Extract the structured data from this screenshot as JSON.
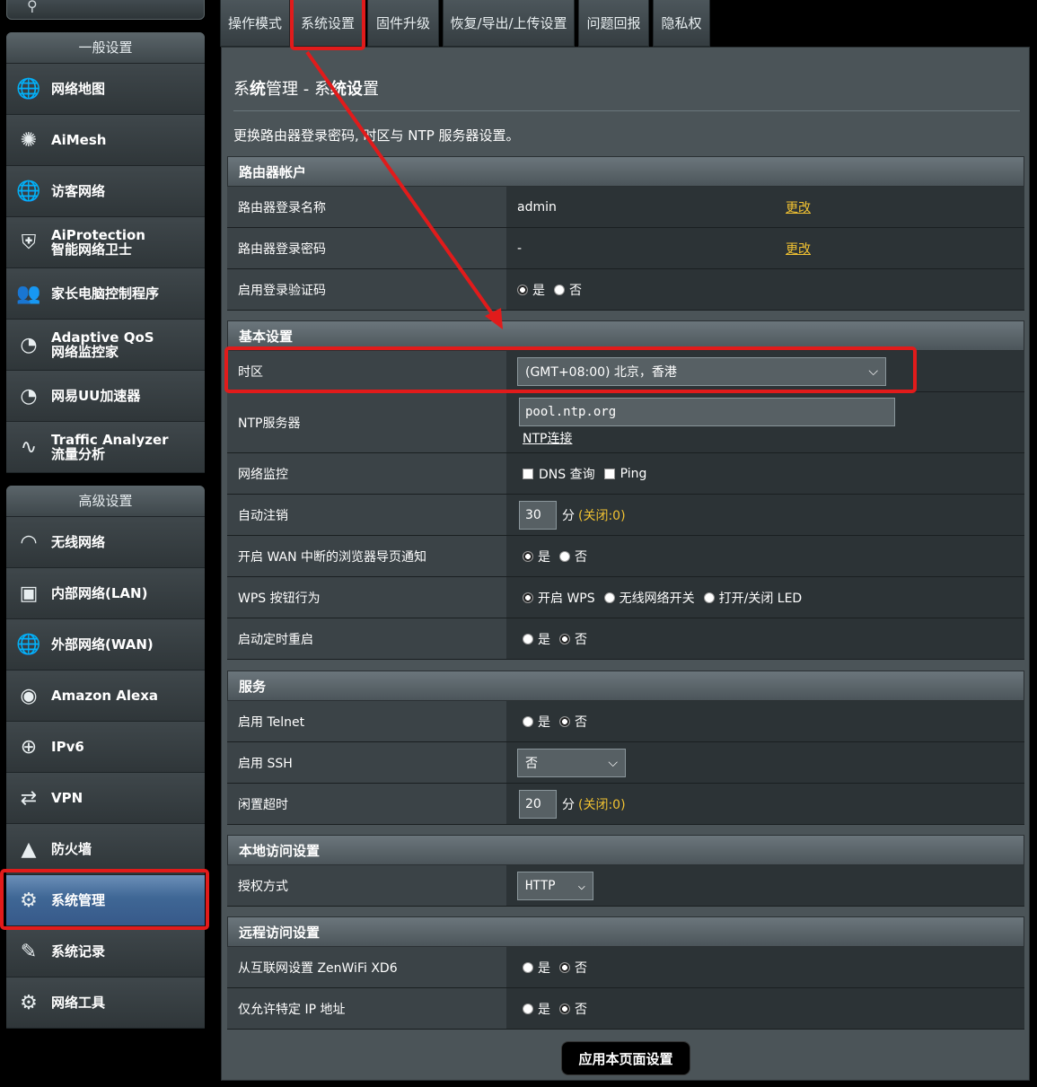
{
  "sidebar": {
    "general_header": "一般设置",
    "general_items": [
      {
        "label": "网络地图",
        "icon": "globe-network-icon"
      },
      {
        "label": "AiMesh",
        "icon": "mesh-icon"
      },
      {
        "label": "访客网络",
        "icon": "guest-network-icon"
      },
      {
        "label": "AiProtection\n智能网络卫士",
        "icon": "shield-lock-icon"
      },
      {
        "label": "家长电脑控制程序",
        "icon": "family-icon"
      },
      {
        "label": "Adaptive QoS\n网络监控家",
        "icon": "gauge-icon"
      },
      {
        "label": "网易UU加速器",
        "icon": "speedometer-icon"
      },
      {
        "label": "Traffic Analyzer\n流量分析",
        "icon": "traffic-wave-icon"
      }
    ],
    "advanced_header": "高级设置",
    "advanced_items": [
      {
        "label": "无线网络",
        "icon": "wifi-icon"
      },
      {
        "label": "内部网络(LAN)",
        "icon": "lan-monitor-icon"
      },
      {
        "label": "外部网络(WAN)",
        "icon": "globe-icon"
      },
      {
        "label": "Amazon Alexa",
        "icon": "alexa-icon"
      },
      {
        "label": "IPv6",
        "icon": "ipv6-icon"
      },
      {
        "label": "VPN",
        "icon": "vpn-icon"
      },
      {
        "label": "防火墙",
        "icon": "firewall-icon"
      },
      {
        "label": "系统管理",
        "icon": "gear-person-icon",
        "active": true
      },
      {
        "label": "系统记录",
        "icon": "log-icon"
      },
      {
        "label": "网络工具",
        "icon": "tools-gear-icon"
      }
    ]
  },
  "tabs": [
    "操作模式",
    "系统设置",
    "固件升级",
    "恢复/导出/上传设置",
    "问题回报",
    "隐私权"
  ],
  "page": {
    "title_pre": "系",
    "title_bold1": "统",
    "title_mid": "管理 - ",
    "title_mid2": "系",
    "title_bold2": "统设",
    "title_end": "置",
    "description": "更换路由器登录密码, 时区与 NTP 服务器设置。"
  },
  "sections": {
    "account": {
      "header": "路由器帐户",
      "login_name_label": "路由器登录名称",
      "login_name_value": "admin",
      "login_pwd_label": "路由器登录密码",
      "login_pwd_value": "-",
      "change": "更改",
      "captcha_label": "启用登录验证码",
      "yes": "是",
      "no": "否"
    },
    "basic": {
      "header": "基本设置",
      "timezone_label": "时区",
      "timezone_value": "(GMT+08:00) 北京，香港",
      "ntp_label": "NTP服务器",
      "ntp_value": "pool.ntp.org",
      "ntp_link": "NTP连接",
      "netmon_label": "网络监控",
      "dns_query": "DNS 查询",
      "ping": "Ping",
      "autologout_label": "自动注销",
      "autologout_value": "30",
      "minutes": "分",
      "off_hint": "(关闭:0)",
      "wan_notify_label": "开启 WAN 中断的浏览器导页通知",
      "wps_label": "WPS 按钮行为",
      "wps_opt1": "开启 WPS",
      "wps_opt2": "无线网络开关",
      "wps_opt3": "打开/关闭 LED",
      "reboot_label": "启动定时重启"
    },
    "service": {
      "header": "服务",
      "telnet_label": "启用 Telnet",
      "ssh_label": "启用 SSH",
      "ssh_value": "否",
      "idle_label": "闲置超时",
      "idle_value": "20"
    },
    "local": {
      "header": "本地访问设置",
      "auth_label": "授权方式",
      "auth_value": "HTTP"
    },
    "remote": {
      "header": "远程访问设置",
      "wan_access_label": "从互联网设置 ZenWiFi XD6",
      "ip_limit_label": "仅允许特定 IP 地址"
    }
  },
  "apply_button": "应用本页面设置",
  "colors": {
    "highlight": "#e11b1b",
    "link": "#f1c232",
    "active_item": "#3f6795"
  }
}
